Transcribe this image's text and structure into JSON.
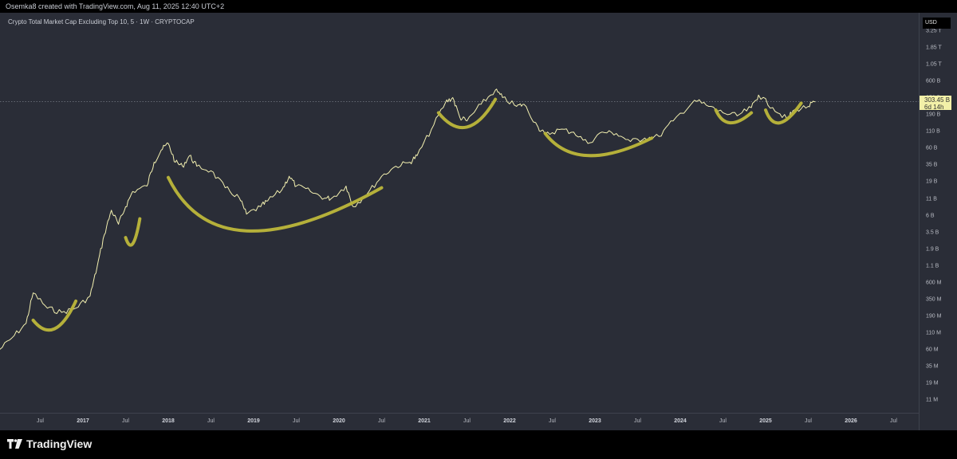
{
  "header": {
    "credit": "Osemka8 created with TradingView.com, Aug 11, 2025 12:40 UTC+2"
  },
  "footer": {
    "brand": "TradingView"
  },
  "chart_data": {
    "type": "line",
    "title": "Crypto Total Market Cap Excluding Top 10, 5 · 1W · CRYPTOCAP",
    "currency": "USD",
    "last_value_label": "303.45 B",
    "countdown": "6d 14h",
    "y_scale": "log",
    "ylabel": "",
    "xlabel": "",
    "y_ticks": [
      "3.25 T",
      "1.85 T",
      "1.05 T",
      "600 B",
      "350 B",
      "190 B",
      "110 B",
      "60 B",
      "35 B",
      "19 B",
      "11 B",
      "6 B",
      "3.5 B",
      "1.9 B",
      "1.1 B",
      "600 M",
      "350 M",
      "190 M",
      "110 M",
      "60 M",
      "35 M",
      "19 M",
      "11 M"
    ],
    "x_ticks": [
      {
        "label": "Jul",
        "year": false
      },
      {
        "label": "2017",
        "year": true
      },
      {
        "label": "Jul",
        "year": false
      },
      {
        "label": "2018",
        "year": true
      },
      {
        "label": "Jul",
        "year": false
      },
      {
        "label": "2019",
        "year": true
      },
      {
        "label": "Jul",
        "year": false
      },
      {
        "label": "2020",
        "year": true
      },
      {
        "label": "Jul",
        "year": false
      },
      {
        "label": "2021",
        "year": true
      },
      {
        "label": "Jul",
        "year": false
      },
      {
        "label": "2022",
        "year": true
      },
      {
        "label": "Jul",
        "year": false
      },
      {
        "label": "2023",
        "year": true
      },
      {
        "label": "Jul",
        "year": false
      },
      {
        "label": "2024",
        "year": true
      },
      {
        "label": "Jul",
        "year": false
      },
      {
        "label": "2025",
        "year": true
      },
      {
        "label": "Jul",
        "year": false
      },
      {
        "label": "2026",
        "year": true
      },
      {
        "label": "Jul",
        "year": false
      }
    ],
    "series": [
      {
        "points": [
          [
            "2016-01",
            70000000.0
          ],
          [
            "2016-03",
            110000000.0
          ],
          [
            "2016-05",
            180000000.0
          ],
          [
            "2016-06",
            500000000.0
          ],
          [
            "2016-08",
            300000000.0
          ],
          [
            "2016-10",
            260000000.0
          ],
          [
            "2016-12",
            300000000.0
          ],
          [
            "2017-02",
            450000000.0
          ],
          [
            "2017-03",
            1200000000.0
          ],
          [
            "2017-04",
            3500000000.0
          ],
          [
            "2017-05",
            8000000000.0
          ],
          [
            "2017-06",
            5000000000.0
          ],
          [
            "2017-07",
            9000000000.0
          ],
          [
            "2017-08",
            15000000000.0
          ],
          [
            "2017-10",
            18000000000.0
          ],
          [
            "2017-11",
            40000000000.0
          ],
          [
            "2017-12",
            60000000000.0
          ],
          [
            "2018-01",
            75000000000.0
          ],
          [
            "2018-02",
            40000000000.0
          ],
          [
            "2018-03",
            35000000000.0
          ],
          [
            "2018-04",
            50000000000.0
          ],
          [
            "2018-05",
            35000000000.0
          ],
          [
            "2018-07",
            30000000000.0
          ],
          [
            "2018-09",
            17000000000.0
          ],
          [
            "2018-11",
            12000000000.0
          ],
          [
            "2018-12",
            7000000000.0
          ],
          [
            "2019-02",
            9000000000.0
          ],
          [
            "2019-03",
            11000000000.0
          ],
          [
            "2019-05",
            16000000000.0
          ],
          [
            "2019-06",
            25000000000.0
          ],
          [
            "2019-07",
            18000000000.0
          ],
          [
            "2019-09",
            15000000000.0
          ],
          [
            "2019-11",
            12000000000.0
          ],
          [
            "2019-12",
            12000000000.0
          ],
          [
            "2020-02",
            18000000000.0
          ],
          [
            "2020-03",
            9000000000.0
          ],
          [
            "2020-05",
            14000000000.0
          ],
          [
            "2020-07",
            25000000000.0
          ],
          [
            "2020-09",
            35000000000.0
          ],
          [
            "2020-11",
            40000000000.0
          ],
          [
            "2020-12",
            50000000000.0
          ],
          [
            "2021-02",
            120000000000.0
          ],
          [
            "2021-04",
            300000000000.0
          ],
          [
            "2021-05",
            350000000000.0
          ],
          [
            "2021-06",
            180000000000.0
          ],
          [
            "2021-07",
            160000000000.0
          ],
          [
            "2021-09",
            280000000000.0
          ],
          [
            "2021-11",
            450000000000.0
          ],
          [
            "2021-12",
            350000000000.0
          ],
          [
            "2022-02",
            260000000000.0
          ],
          [
            "2022-03",
            280000000000.0
          ],
          [
            "2022-05",
            130000000000.0
          ],
          [
            "2022-06",
            100000000000.0
          ],
          [
            "2022-08",
            120000000000.0
          ],
          [
            "2022-10",
            110000000000.0
          ],
          [
            "2022-12",
            75000000000.0
          ],
          [
            "2023-02",
            110000000000.0
          ],
          [
            "2023-04",
            105000000000.0
          ],
          [
            "2023-06",
            80000000000.0
          ],
          [
            "2023-08",
            90000000000.0
          ],
          [
            "2023-10",
            95000000000.0
          ],
          [
            "2023-12",
            160000000000.0
          ],
          [
            "2024-03",
            320000000000.0
          ],
          [
            "2024-05",
            260000000000.0
          ],
          [
            "2024-07",
            210000000000.0
          ],
          [
            "2024-09",
            190000000000.0
          ],
          [
            "2024-11",
            250000000000.0
          ],
          [
            "2024-12",
            380000000000.0
          ],
          [
            "2025-02",
            250000000000.0
          ],
          [
            "2025-04",
            170000000000.0
          ],
          [
            "2025-05",
            230000000000.0
          ],
          [
            "2025-07",
            260000000000.0
          ],
          [
            "2025-08",
            303450000000.0
          ]
        ]
      }
    ],
    "annotations": [
      {
        "shape": "curve",
        "color": "#b5b03a",
        "points": [
          [
            "2016-06",
            200000000.0
          ],
          [
            "2016-09",
            150000000.0
          ],
          [
            "2016-12",
            380000000.0
          ]
        ]
      },
      {
        "shape": "curve",
        "color": "#b5b03a",
        "points": [
          [
            "2017-07",
            3200000000.0
          ],
          [
            "2017-08",
            2600000000.0
          ],
          [
            "2017-09",
            6000000000.0
          ]
        ]
      },
      {
        "shape": "curve",
        "color": "#b5b03a",
        "points": [
          [
            "2018-01",
            24000000000.0
          ],
          [
            "2018-12",
            4000000000.0
          ],
          [
            "2020-07",
            17000000000.0
          ]
        ]
      },
      {
        "shape": "curve",
        "color": "#b5b03a",
        "points": [
          [
            "2021-03",
            210000000000.0
          ],
          [
            "2021-07",
            130000000000.0
          ],
          [
            "2021-11",
            330000000000.0
          ]
        ]
      },
      {
        "shape": "curve",
        "color": "#b5b03a",
        "points": [
          [
            "2022-06",
            105000000000.0
          ],
          [
            "2022-12",
            50000000000.0
          ],
          [
            "2023-09",
            90000000000.0
          ]
        ]
      },
      {
        "shape": "curve",
        "color": "#b5b03a",
        "points": [
          [
            "2024-06",
            230000000000.0
          ],
          [
            "2024-08",
            150000000000.0
          ],
          [
            "2024-11",
            210000000000.0
          ]
        ]
      },
      {
        "shape": "curve",
        "color": "#b5b03a",
        "points": [
          [
            "2025-01",
            230000000000.0
          ],
          [
            "2025-03",
            150000000000.0
          ],
          [
            "2025-06",
            290000000000.0
          ]
        ]
      }
    ],
    "grid": false,
    "colors": {
      "background": "#2a2d37",
      "line": "#f3f0b0",
      "annotation": "#b5b03a",
      "price_tag": "#f2f0a8"
    }
  }
}
